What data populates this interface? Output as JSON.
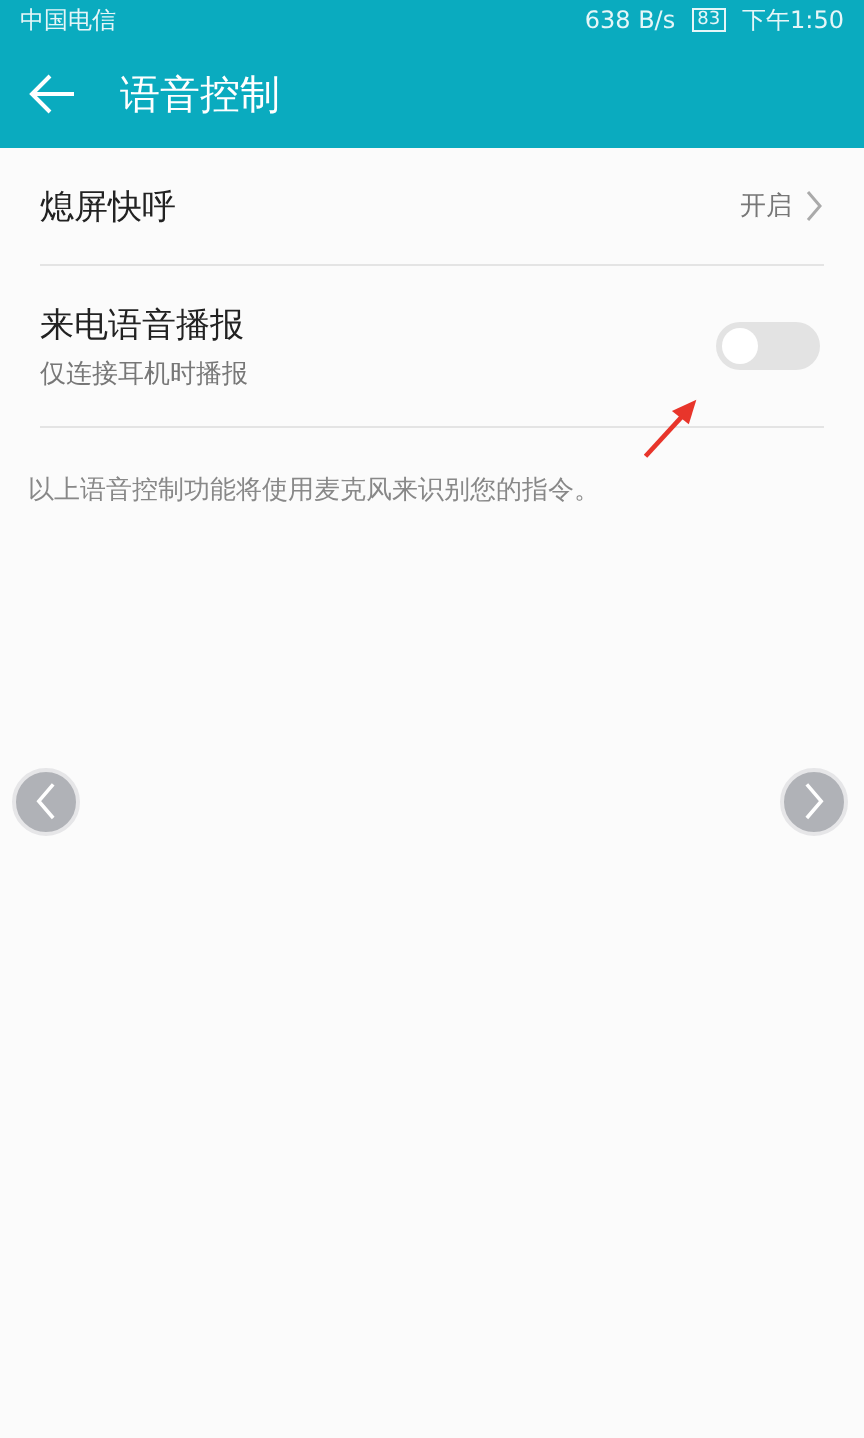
{
  "status_bar": {
    "carrier": "中国电信",
    "speed": "638 B/s",
    "battery": "83",
    "time": "下午1:50"
  },
  "app_bar": {
    "title": "语音控制"
  },
  "settings": [
    {
      "kind": "link",
      "title": "熄屏快呼",
      "value": "开启"
    },
    {
      "kind": "toggle",
      "title": "来电语音播报",
      "subtitle": "仅连接耳机时播报",
      "on": false
    }
  ],
  "note": "以上语音控制功能将使用麦克风来识别您的指令。"
}
